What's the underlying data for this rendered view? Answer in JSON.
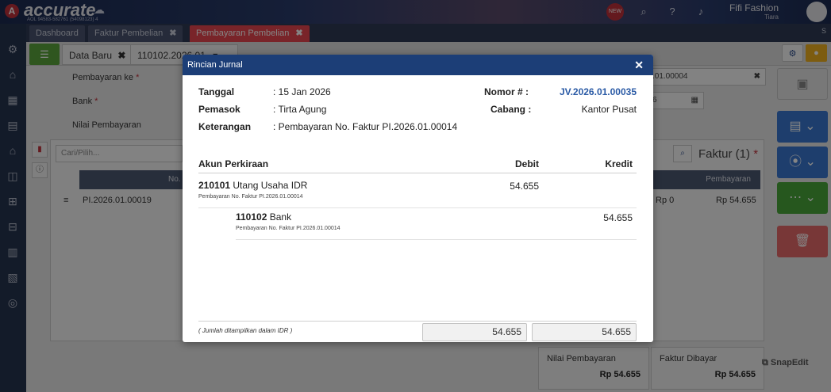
{
  "app": {
    "logo_letter": "A",
    "logo_text": "accurate",
    "logo_sub": "AOL 94583-582761 (54098123) 4",
    "user_name": "Fifi Fashion",
    "user_sub": "Tiara",
    "new_badge": "NEW"
  },
  "tabs": [
    {
      "label": "Dashboard"
    },
    {
      "label": "Faktur Pembelian",
      "close": "✖"
    },
    {
      "label": "Pembayaran Pembelian",
      "close": "✖"
    }
  ],
  "tab_s": "S",
  "subtabs": {
    "data_baru": "Data Baru",
    "close": "✖",
    "doc": "110102.2026.01",
    "doc_chevron": "▾"
  },
  "form": {
    "pembayaran_ke": "Pembayaran ke",
    "bank": "Bank",
    "nilai_pembayaran": "Nilai Pembayaran",
    "req": "*",
    "search_placeholder": "Cari/Pilih...",
    "right_input1": ".01.00004",
    "right_input2": "6",
    "col_no": "No.",
    "col_pembayaran": "Pembayaran",
    "row_no": "PI.2026.01.00019",
    "row_rp0": "Rp 0",
    "row_pay": "Rp 54.655",
    "faktur_title": "Faktur (1)"
  },
  "bottom": {
    "nilai_label": "Nilai Pembayaran",
    "nilai_val": "Rp 54.655",
    "faktur_label": "Faktur Dibayar",
    "faktur_val": "Rp 54.655",
    "snapedit": "SnapEdit"
  },
  "modal": {
    "title": "Rincian Jurnal",
    "close": "✕",
    "tanggal_label": "Tanggal",
    "tanggal_val": ": 15 Jan 2026",
    "pemasok_label": "Pemasok",
    "pemasok_val": ": Tirta Agung",
    "keterangan_label": "Keterangan",
    "keterangan_val": ": Pembayaran No. Faktur PI.2026.01.00014",
    "nomor_label": "Nomor # :",
    "nomor_val": "JV.2026.01.00035",
    "cabang_label": "Cabang :",
    "cabang_val": "Kantor Pusat",
    "col_akun": "Akun Perkiraan",
    "col_debit": "Debit",
    "col_kredit": "Kredit",
    "entries": [
      {
        "code": "210101",
        "name": "Utang Usaha IDR",
        "note": "Pembayaran No. Faktur PI.2026.01.00014",
        "debit": "54.655",
        "kredit": ""
      },
      {
        "code": "110102",
        "name": "Bank",
        "note": "Pembayaran No. Faktur PI.2026.01.00014",
        "debit": "",
        "kredit": "54.655"
      }
    ],
    "footer_note": "( Jumlah ditampilkan dalam IDR )",
    "total_debit": "54.655",
    "total_kredit": "54.655"
  },
  "colors": {
    "header": "#1c3e77",
    "link": "#2a5aa5",
    "accent_red": "#e8464f",
    "green": "#5aa53c"
  }
}
